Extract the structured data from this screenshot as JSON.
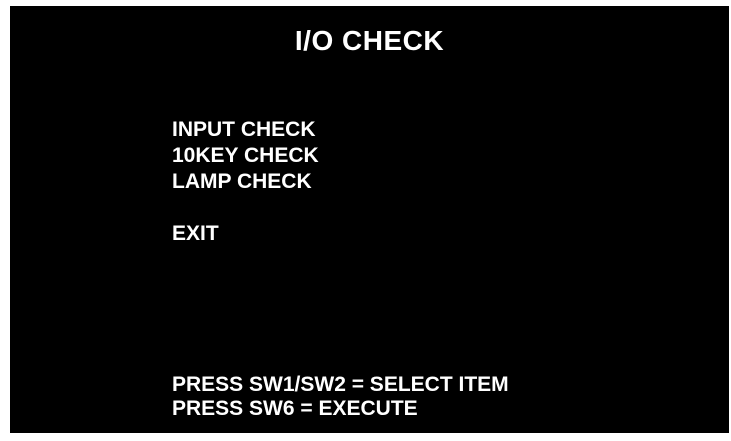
{
  "screen": {
    "title": "I/O CHECK"
  },
  "menu": {
    "items": [
      {
        "label": "INPUT CHECK"
      },
      {
        "label": "10KEY CHECK"
      },
      {
        "label": "LAMP CHECK"
      }
    ],
    "exit_label": "EXIT"
  },
  "instructions": {
    "line1": "PRESS SW1/SW2 = SELECT ITEM",
    "line2": "PRESS SW6 = EXECUTE"
  },
  "colors": {
    "background": "#000000",
    "text": "#ffffff"
  }
}
